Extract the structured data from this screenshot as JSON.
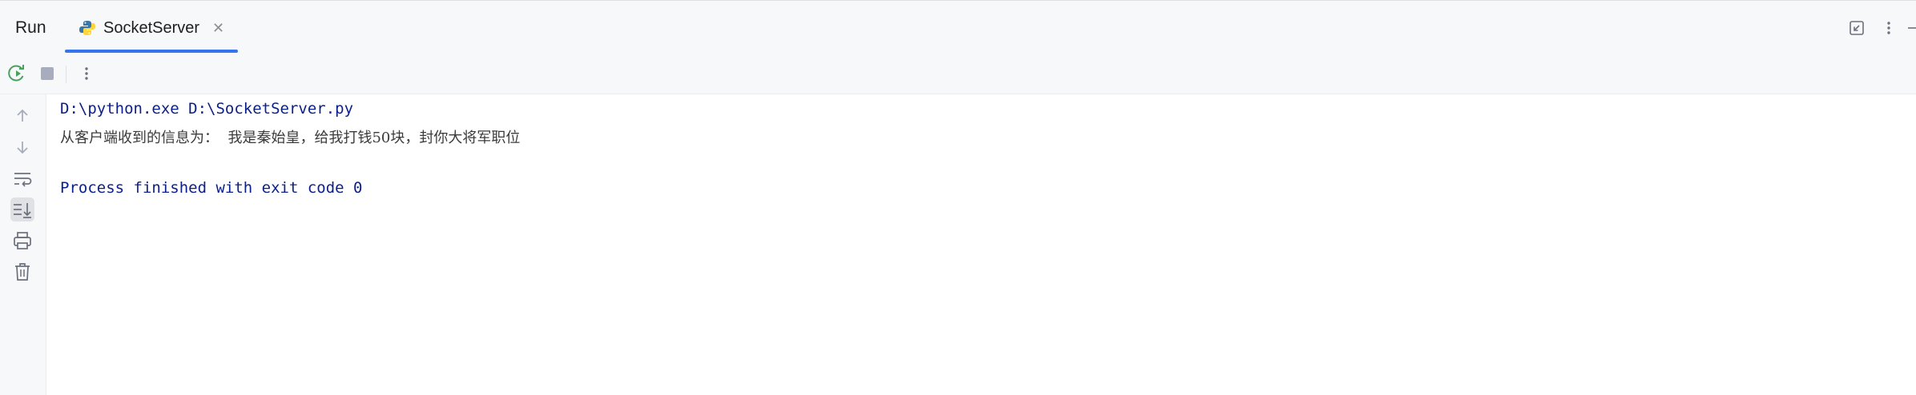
{
  "header": {
    "title": "Run",
    "tab": {
      "label": "SocketServer",
      "icon": "python-icon",
      "close_icon": "close-icon"
    },
    "right_icons": [
      "restore-layout-icon",
      "more-vertical-icon"
    ]
  },
  "toolbar": {
    "buttons": [
      "rerun-icon",
      "stop-icon",
      "more-vertical-icon"
    ]
  },
  "sidebar": {
    "buttons": [
      "arrow-up-icon",
      "arrow-down-icon",
      "soft-wrap-icon",
      "scroll-to-end-icon",
      "print-icon",
      "trash-icon"
    ],
    "active": "scroll-to-end-icon"
  },
  "console": {
    "command": "D:\\python.exe D:\\SocketServer.py",
    "output": "从客户端收到的信息为：  我是秦始皇，给我打钱50块，封你大将军职位",
    "exit_message": "Process finished with exit code 0"
  },
  "colors": {
    "accent": "#3574f0",
    "command_text": "#0b1f8a",
    "output_text": "#3b3b3b",
    "rerun_green": "#4aa15d"
  }
}
